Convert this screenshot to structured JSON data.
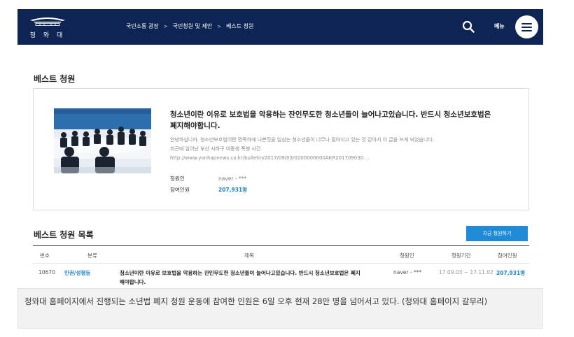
{
  "header": {
    "logo_text": "청 와 대",
    "breadcrumbs": [
      "국민소통 광장",
      "국민청원 및 제안",
      "베스트 청원"
    ],
    "breadcrumb_sep": ">",
    "menu_label": "메뉴",
    "icons": {
      "search": "search-icon",
      "menu": "hamburger-icon"
    },
    "bg_color": "#0e2553"
  },
  "best": {
    "heading": "베스트 청원",
    "title": "청소년이란 이유로 보호법을 악용하는 잔인무도한 청소년들이 늘어나고있습니다. 반드시 청소년보호법은 폐지해야합니다.",
    "body_lines": [
      "안녕하십니까. 청소년보호법이란 명목하에 나쁜짓을 일삼는 청소년들이 너무나 많아지고 있는 것 같아서 이 글을 쓰게 되었습니다.",
      "최근에 일어난 부산 사하구 여중생 폭행 사건",
      "http://www.yonhapnews.co.kr/bulletin/2017/09/03/0200000000AKR201709030 ..."
    ],
    "petitioner_label": "청원인",
    "petitioner": "naver - ***",
    "participants_label": "참여인원",
    "participants": "207,931명"
  },
  "list": {
    "heading": "베스트 청원 목록",
    "start_button": "지금 청원하기",
    "columns": [
      "번호",
      "분류",
      "제목",
      "청원인",
      "청원기간",
      "참여인원"
    ],
    "rows": [
      {
        "no": "10670",
        "category": "인권/성평등",
        "title": "청소년이란 이유로 보호법을 악용하는 잔인무도한 청소년들이 늘어나고있습니다. 반드시 청소년보호법은 폐지해야합니다.",
        "petitioner": "naver - ***",
        "period": "17.09.03 ~ 17.11.02",
        "count": "207,931명"
      }
    ]
  },
  "caption": "청와대 홈페이지에서 진행되는 소년법 폐지 청원 운동에 참여한 인원은 6일 오후 현재 28만 명을 넘어서고 있다. (청와대 홈페이지 갈무리)",
  "colors": {
    "accent": "#1f8ad6",
    "link": "#1a7fc9",
    "navy": "#0e2553"
  }
}
